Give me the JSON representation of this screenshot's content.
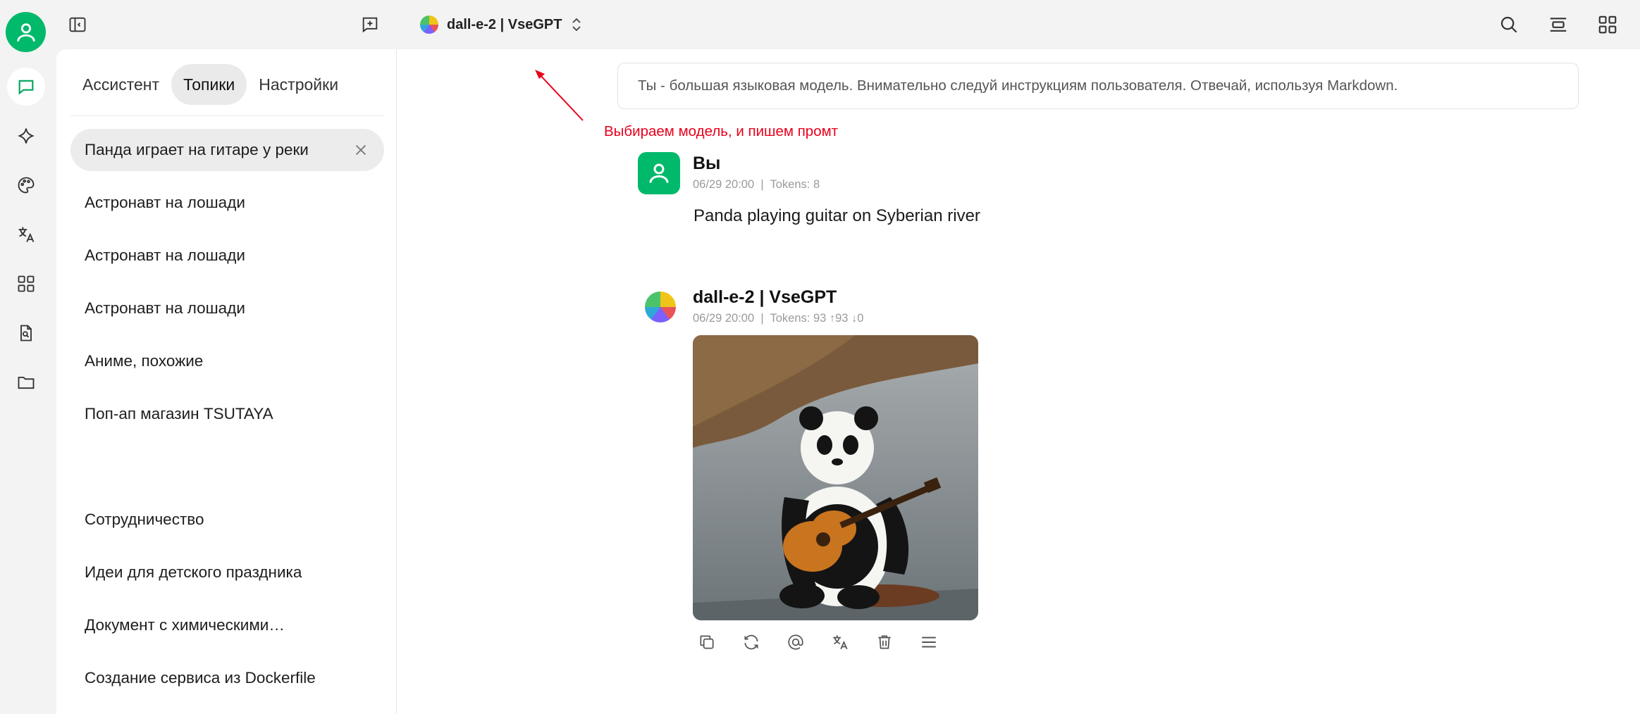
{
  "header": {
    "model_name": "dall-e-2 | VseGPT"
  },
  "sidebar": {
    "tabs": [
      {
        "label": "Ассистент",
        "active": false
      },
      {
        "label": "Топики",
        "active": true
      },
      {
        "label": "Настройки",
        "active": false
      }
    ],
    "topics": [
      {
        "label": "Панда играет на гитаре у реки",
        "active": true
      },
      {
        "label": "Астронавт на лошади",
        "active": false
      },
      {
        "label": "Астронавт на лошади",
        "active": false
      },
      {
        "label": "Астронавт на лошади",
        "active": false
      },
      {
        "label": "Аниме, похожие",
        "active": false
      },
      {
        "label": "Поп-ап магазин TSUTAYA",
        "active": false
      },
      {
        "label": "",
        "active": false
      },
      {
        "label": "Сотрудничество",
        "active": false
      },
      {
        "label": "Идеи для детского праздника",
        "active": false
      },
      {
        "label": "Документ с химическими…",
        "active": false
      },
      {
        "label": "Создание сервиса из Dockerfile",
        "active": false
      }
    ]
  },
  "main": {
    "system_prompt": "Ты - большая языковая модель. Внимательно следуй инструкциям пользователя. Отвечай, используя Markdown.",
    "annotation": "Выбираем модель, и пишем промт",
    "messages": [
      {
        "author": "Вы",
        "meta": "06/29 20:00  |  Tokens: 8",
        "text": "Panda playing guitar on Syberian river"
      },
      {
        "author": "dall-e-2 | VseGPT",
        "meta": "06/29 20:00  |  Tokens: 93 ↑93 ↓0"
      }
    ]
  },
  "colors": {
    "accent": "#00b96b",
    "annotation": "#e8001c",
    "sidebar_bg": "#f3f3f3"
  },
  "icons": {
    "rail": [
      "chat-icon",
      "sparkle-icon",
      "palette-icon",
      "translate-icon",
      "apps-icon",
      "file-search-icon",
      "folder-icon"
    ],
    "actions": [
      "copy-icon",
      "regenerate-icon",
      "mention-icon",
      "translate-icon",
      "delete-icon",
      "menu-icon"
    ]
  }
}
